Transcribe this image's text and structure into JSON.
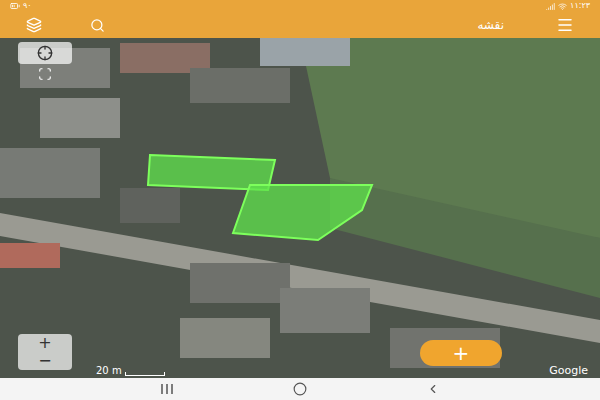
{
  "status_bar": {
    "time": "۱۱:۲۳",
    "battery": "۹۰"
  },
  "app_bar": {
    "title": "نقشه"
  },
  "map": {
    "scale": "20 m",
    "attribution": "Google"
  },
  "zoom": {
    "in": "+",
    "out": "−"
  },
  "fab": {
    "label": "+"
  }
}
